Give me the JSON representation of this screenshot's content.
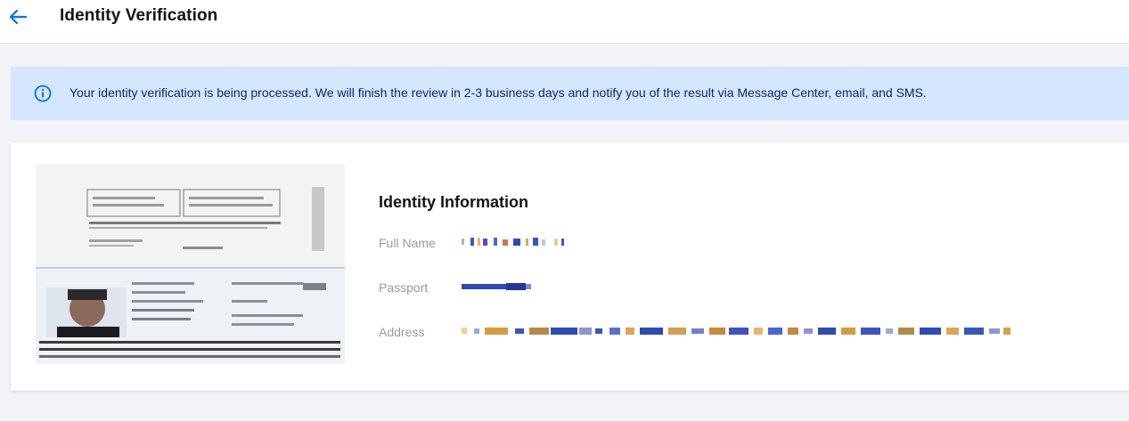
{
  "header": {
    "title": "Identity Verification"
  },
  "notice": {
    "text": "Your identity verification is being processed. We will finish the review in 2-3 business days and notify you of the result via Message Center, email, and SMS."
  },
  "identity": {
    "section_title": "Identity Information",
    "rows": [
      {
        "label": "Full Name"
      },
      {
        "label": "Passport"
      },
      {
        "label": "Address"
      }
    ]
  },
  "colors": {
    "accent": "#006eff",
    "notice_bg": "#d5e6ff",
    "notice_text": "#0a2a66"
  }
}
